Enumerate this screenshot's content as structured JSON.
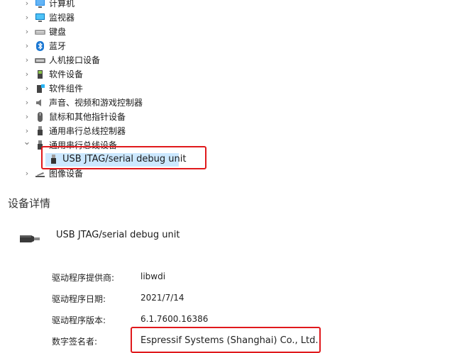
{
  "tree": {
    "items": [
      {
        "label": "计算机",
        "expanded": false,
        "icon": "computer-icon"
      },
      {
        "label": "监视器",
        "expanded": false,
        "icon": "monitor-icon"
      },
      {
        "label": "键盘",
        "expanded": false,
        "icon": "keyboard-icon"
      },
      {
        "label": "蓝牙",
        "expanded": false,
        "icon": "bluetooth-icon"
      },
      {
        "label": "人机接口设备",
        "expanded": false,
        "icon": "hid-icon"
      },
      {
        "label": "软件设备",
        "expanded": false,
        "icon": "software-device-icon"
      },
      {
        "label": "软件组件",
        "expanded": false,
        "icon": "software-component-icon"
      },
      {
        "label": "声音、视频和游戏控制器",
        "expanded": false,
        "icon": "speaker-icon"
      },
      {
        "label": "鼠标和其他指针设备",
        "expanded": false,
        "icon": "mouse-icon"
      },
      {
        "label": "通用串行总线控制器",
        "expanded": false,
        "icon": "usb-icon"
      },
      {
        "label": "通用串行总线设备",
        "expanded": true,
        "icon": "usb-icon"
      },
      {
        "label": "USB JTAG/serial debug unit",
        "child": true,
        "selected": true,
        "icon": "usb-plug-icon"
      },
      {
        "label": "图像设备",
        "expanded": false,
        "icon": "camera-icon"
      }
    ]
  },
  "details": {
    "section_title": "设备详情",
    "device_name": "USB JTAG/serial debug unit",
    "props": [
      {
        "label": "驱动程序提供商:",
        "value": "libwdi"
      },
      {
        "label": "驱动程序日期:",
        "value": "2021/7/14"
      },
      {
        "label": "驱动程序版本:",
        "value": "6.1.7600.16386"
      },
      {
        "label": "数字签名者:",
        "value": "Espressif Systems (Shanghai) Co., Ltd."
      }
    ]
  },
  "colors": {
    "highlight": "#e0191c",
    "selection": "#cce8ff"
  }
}
